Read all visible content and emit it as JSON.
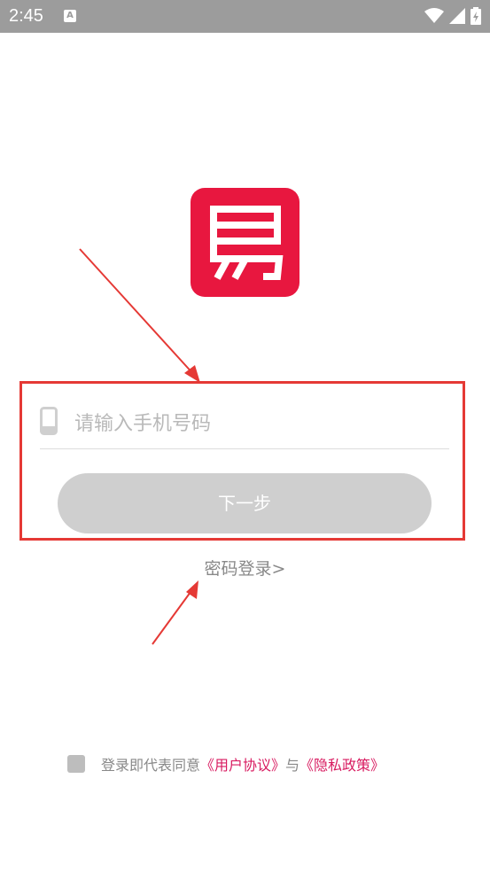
{
  "status_bar": {
    "time": "2:45",
    "notification_icon": "A",
    "icons": [
      "wifi-icon",
      "signal-icon",
      "battery-icon"
    ]
  },
  "app": {
    "logo_icon": "app-logo-icon",
    "brand_color": "#e8173f"
  },
  "login": {
    "phone_placeholder": "请输入手机号码",
    "phone_value": "",
    "next_label": "下一步",
    "password_login_link": "密码登录>"
  },
  "agreement": {
    "checked": false,
    "prefix": "登录即代表同意",
    "user_agreement": "《用户协议》",
    "conjunction": "与",
    "privacy_policy": "《隐私政策》"
  },
  "colors": {
    "status_bar": "#9c9c9c",
    "link": "#d81b60",
    "annotation": "#e53935",
    "button_disabled": "#cfcfcf"
  }
}
